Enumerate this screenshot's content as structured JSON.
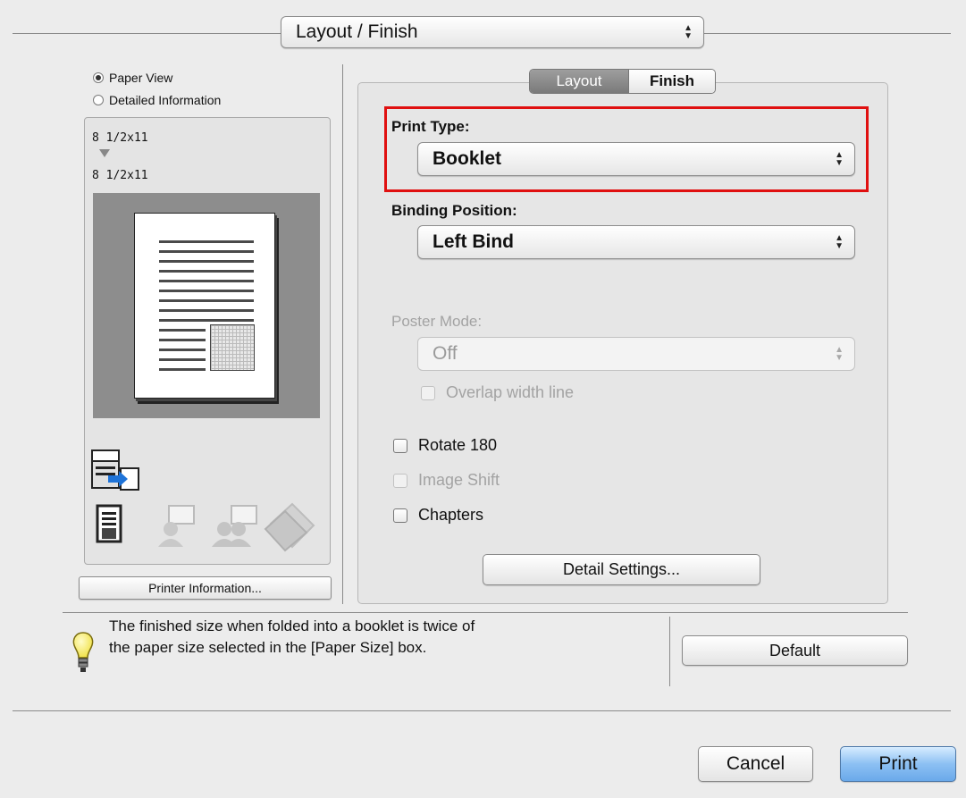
{
  "section_selector": {
    "value": "Layout / Finish"
  },
  "preview": {
    "view_options": [
      {
        "label": "Paper View",
        "selected": true
      },
      {
        "label": "Detailed Information",
        "selected": false
      }
    ],
    "original_size": "8 1/2x11",
    "output_size": "8 1/2x11",
    "printer_info_button": "Printer Information..."
  },
  "tabs": [
    {
      "label": "Layout",
      "selected": true
    },
    {
      "label": "Finish",
      "selected": false
    }
  ],
  "print_type": {
    "label": "Print Type:",
    "value": "Booklet"
  },
  "binding_position": {
    "label": "Binding Position:",
    "value": "Left Bind"
  },
  "poster_mode": {
    "label": "Poster Mode:",
    "value": "Off",
    "enabled": false
  },
  "overlap_width_line": {
    "label": "Overlap width line",
    "checked": false,
    "enabled": false
  },
  "rotate_180": {
    "label": "Rotate 180",
    "checked": false
  },
  "image_shift": {
    "label": "Image Shift",
    "checked": false,
    "enabled": false
  },
  "chapters": {
    "label": "Chapters",
    "checked": false
  },
  "detail_settings_button": "Detail Settings...",
  "hint": {
    "line1": "The finished size when folded into a booklet is twice of",
    "line2": "the paper size selected in the [Paper Size] box."
  },
  "default_button": "Default",
  "cancel_button": "Cancel",
  "print_button": "Print",
  "colors": {
    "highlight": "#e01010",
    "primary_button": "#7ab6ef"
  }
}
